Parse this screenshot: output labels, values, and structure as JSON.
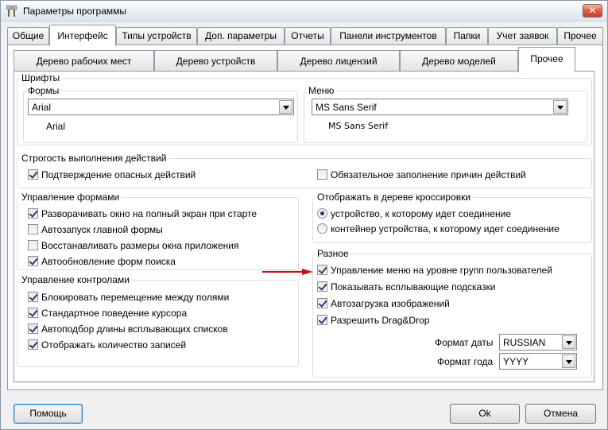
{
  "window": {
    "title": "Параметры программы",
    "close_label": "✕"
  },
  "tabs": [
    {
      "label": "Общие"
    },
    {
      "label": "Интерфейс"
    },
    {
      "label": "Типы устройств"
    },
    {
      "label": "Доп. параметры"
    },
    {
      "label": "Отчеты"
    },
    {
      "label": "Панели инструментов"
    },
    {
      "label": "Папки"
    },
    {
      "label": "Учет заявок"
    },
    {
      "label": "Прочее"
    }
  ],
  "subtabs": [
    {
      "label": "Дерево рабочих мест"
    },
    {
      "label": "Дерево устройств"
    },
    {
      "label": "Дерево лицензий"
    },
    {
      "label": "Дерево моделей"
    },
    {
      "label": "Прочее"
    }
  ],
  "fonts": {
    "title": "Шрифты",
    "forms": {
      "title": "Формы",
      "value": "Arial",
      "preview": "Arial"
    },
    "menu": {
      "title": "Меню",
      "value": "MS Sans Serif",
      "preview": "MS Sans Serif"
    }
  },
  "strict": {
    "title": "Строгость выполнения действий",
    "items": [
      {
        "label": "Подтверждение опасных действий",
        "checked": true
      },
      {
        "label": "Обязательное заполнение причин действий",
        "checked": false
      }
    ]
  },
  "forms_control": {
    "title": "Управление формами",
    "items": [
      {
        "label": "Разворачивать окно на полный экран при старте",
        "checked": true
      },
      {
        "label": "Автозапуск главной формы",
        "checked": false
      },
      {
        "label": "Восстанавливать размеры окна приложения",
        "checked": false
      },
      {
        "label": "Автообновление форм поиска",
        "checked": true
      }
    ]
  },
  "controls": {
    "title": "Управление контролами",
    "items": [
      {
        "label": "Блокировать перемещение между полями",
        "checked": true
      },
      {
        "label": "Стандартное поведение курсора",
        "checked": true
      },
      {
        "label": "Автоподбор длины всплывающих списков",
        "checked": true
      },
      {
        "label": "Отображать количество записей",
        "checked": true
      }
    ]
  },
  "crossing": {
    "title": "Отображать в дереве кроссировки",
    "options": [
      {
        "label": "устройство, к которому идет соединение",
        "checked": true
      },
      {
        "label": "контейнер устройства, к которому идет соединение",
        "checked": false
      }
    ]
  },
  "misc": {
    "title": "Разное",
    "items": [
      {
        "label": "Управление меню на уровне групп пользователей",
        "checked": true
      },
      {
        "label": "Показывать всплывающие подсказки",
        "checked": true
      },
      {
        "label": "Автозагрузка изображений",
        "checked": true
      },
      {
        "label": "Разрешить Drag&Drop",
        "checked": true
      }
    ],
    "date_format": {
      "label": "Формат даты",
      "value": "RUSSIAN"
    },
    "year_format": {
      "label": "Формат года",
      "value": "YYYY"
    }
  },
  "buttons": {
    "help": "Помощь",
    "ok": "Ok",
    "cancel": "Отмена"
  },
  "colors": {
    "arrow": "#c0141a",
    "accent": "#2b7ac5"
  }
}
